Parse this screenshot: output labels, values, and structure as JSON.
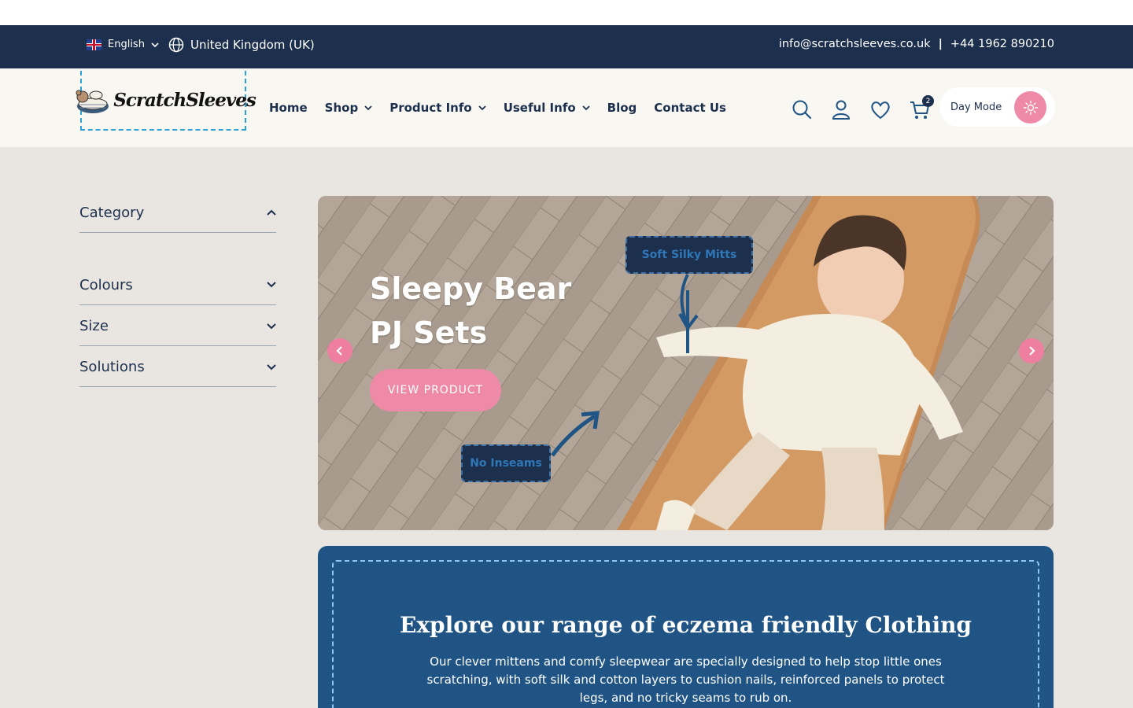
{
  "topbar": {
    "language": "English",
    "region": "United Kingdom (UK)",
    "email": "info@scratchsleeves.co.uk",
    "separator": "|",
    "phone": "+44 1962 890210"
  },
  "header": {
    "logo_text": "ScratchSleeves",
    "nav": [
      {
        "label": "Home",
        "dropdown": false
      },
      {
        "label": "Shop",
        "dropdown": true
      },
      {
        "label": "Product Info",
        "dropdown": true
      },
      {
        "label": "Useful Info",
        "dropdown": true
      },
      {
        "label": "Blog",
        "dropdown": false
      },
      {
        "label": "Contact Us",
        "dropdown": false
      }
    ],
    "cart_count": "2",
    "mode_label": "Day Mode"
  },
  "sidebar": {
    "filters": [
      "Category",
      "Colours",
      "Size",
      "Solutions"
    ]
  },
  "hero": {
    "title": "Sleepy Bear PJ Sets",
    "button": "VIEW PRODUCT",
    "callout_top": "Soft Silky Mitts",
    "callout_bottom": "No Inseams"
  },
  "promo": {
    "title": "Explore our range of eczema friendly Clothing",
    "text": "Our clever mittens and comfy sleepwear are specially designed to help stop little ones scratching, with soft silk and cotton layers to cushion nails, reinforced panels to protect legs, and no tricky seams to rub on."
  },
  "colors": {
    "navy": "#1c2f4d",
    "pink": "#ee8aa8",
    "blue": "#1f5485",
    "cream": "#f9f7f2",
    "page_bg": "#e9e5e0"
  }
}
